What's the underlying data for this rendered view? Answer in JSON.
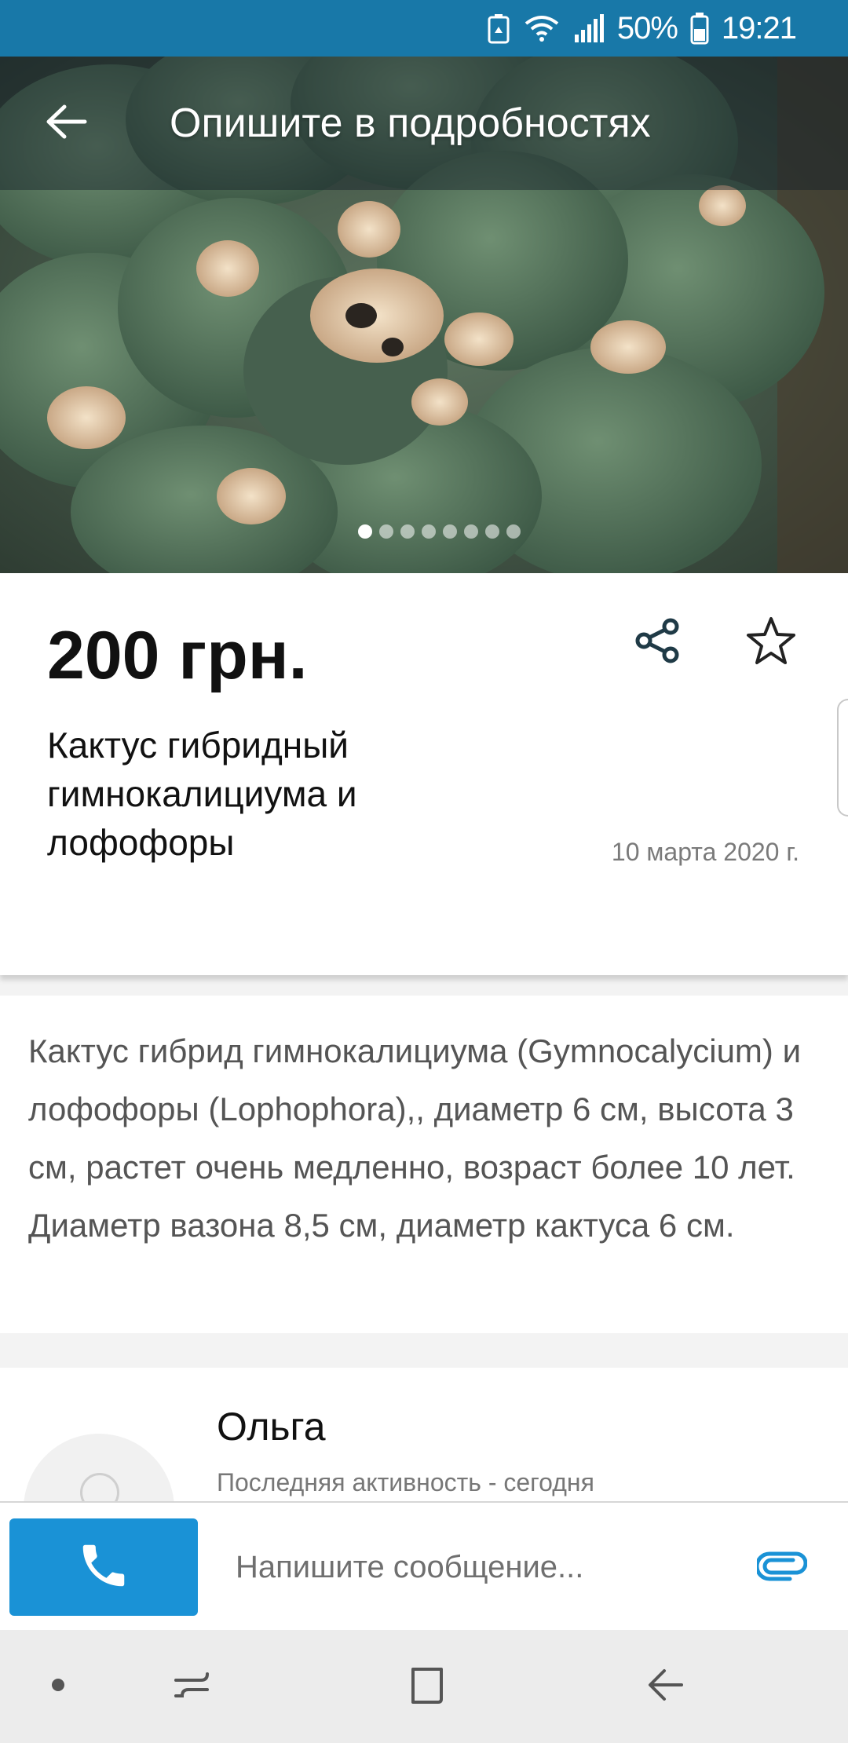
{
  "status_bar": {
    "battery_percent": "50%",
    "time": "19:21",
    "icons": [
      "battery-saver-icon",
      "wifi-icon",
      "signal-icon",
      "battery-icon"
    ]
  },
  "toolbar": {
    "title": "Опишите в подробностях",
    "back_icon": "arrow-left-icon"
  },
  "gallery": {
    "image_count": 8,
    "active_index": 0
  },
  "listing": {
    "price": "200 грн.",
    "title": "Кактус гибридный гимнокалициума и лофофоры",
    "date": "10 марта 2020 г.",
    "share_icon": "share-icon",
    "favorite_icon": "star-outline-icon"
  },
  "description": {
    "text": "Кактус гибрид гимнокалициума (Gymnocalycium) и лофофоры (Lophophora),, диаметр 6 см, высота 3 см, растет очень медленно, возраст более 10 лет. Диаметр вазона 8,5 см, диаметр кактуса 6 см."
  },
  "seller": {
    "name": "Ольга",
    "activity": "Последняя активность - сегодня"
  },
  "message_bar": {
    "call_icon": "phone-icon",
    "placeholder": "Напишите сообщение...",
    "attach_icon": "paperclip-icon"
  },
  "colors": {
    "status_bar": "#1878a8",
    "call_button": "#1a92d6",
    "share_icon": "#1f3a46",
    "attach_icon": "#1a92d6"
  },
  "nav_bar": {
    "buttons": [
      "dot-icon",
      "recent-apps-icon",
      "home-icon",
      "back-icon"
    ]
  }
}
